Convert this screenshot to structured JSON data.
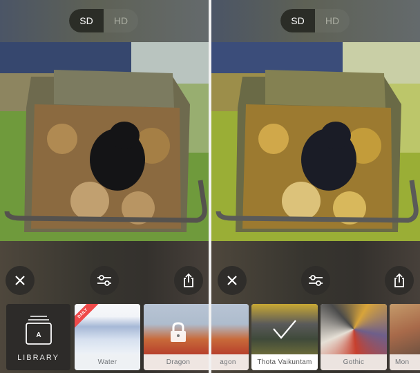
{
  "quality_toggle": {
    "options": [
      {
        "label": "SD",
        "active": true
      },
      {
        "label": "HD",
        "active": false
      }
    ]
  },
  "panes": [
    {
      "id": "original",
      "photo": "black-puppy-in-wheelbarrow-of-leaves"
    },
    {
      "id": "stylized",
      "photo": "black-puppy-in-wheelbarrow-of-leaves-stylized"
    }
  ],
  "actions": {
    "close": "close-icon",
    "adjust": "sliders-icon",
    "share": "share-icon"
  },
  "library": {
    "label": "LIBRARY",
    "badge_letter": "A"
  },
  "left_styles": [
    {
      "label": "Water",
      "badge": "DAILY",
      "locked": false
    },
    {
      "label": "Dragon",
      "locked": true
    }
  ],
  "right_styles": [
    {
      "label": "agon",
      "locked": true
    },
    {
      "label": "Thota Vaikuntam",
      "selected": true
    },
    {
      "label": "Gothic"
    },
    {
      "label": "Mon"
    }
  ],
  "colors": {
    "accent_daily": "#ef4a4a",
    "divider": "#f2f2f2"
  }
}
